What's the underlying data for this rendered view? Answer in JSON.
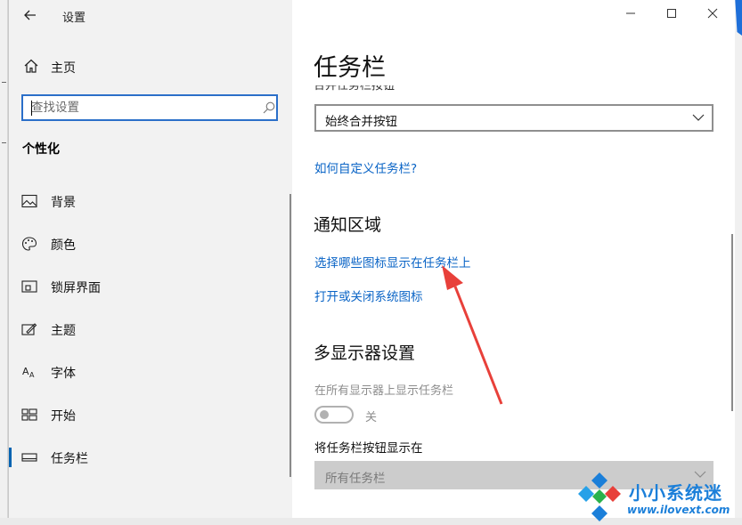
{
  "window": {
    "title": "设置",
    "controls": {
      "minimize": "—",
      "maximize": "☐",
      "close": "✕"
    }
  },
  "sidebar": {
    "home_label": "主页",
    "search": {
      "placeholder": "查找设置"
    },
    "section_title": "个性化",
    "items": [
      {
        "label": "背景",
        "icon": "picture-icon"
      },
      {
        "label": "颜色",
        "icon": "palette-icon"
      },
      {
        "label": "锁屏界面",
        "icon": "lock-screen-icon"
      },
      {
        "label": "主题",
        "icon": "theme-icon"
      },
      {
        "label": "字体",
        "icon": "font-icon"
      },
      {
        "label": "开始",
        "icon": "start-icon"
      },
      {
        "label": "任务栏",
        "icon": "taskbar-icon",
        "active": true
      }
    ]
  },
  "main": {
    "title": "任务栏",
    "combine_label": "合并任务栏按钮",
    "combine_value": "始终合并按钮",
    "customize_link": "如何自定义任务栏?",
    "notification_heading": "通知区域",
    "notification_links": [
      "选择哪些图标显示在任务栏上",
      "打开或关闭系统图标"
    ],
    "multi_display_heading": "多显示器设置",
    "show_all_displays_label": "在所有显示器上显示任务栏",
    "show_all_displays_state": "关",
    "buttons_on_label": "将任务栏按钮显示在",
    "buttons_on_value": "所有任务栏"
  },
  "watermark": {
    "name": "小小系统迷",
    "url": "www.ilovext.com"
  },
  "colors": {
    "accent": "#0063b1",
    "link": "#0a64c6",
    "annotation_arrow": "#e8403a",
    "watermark": "#1b7fd9"
  }
}
